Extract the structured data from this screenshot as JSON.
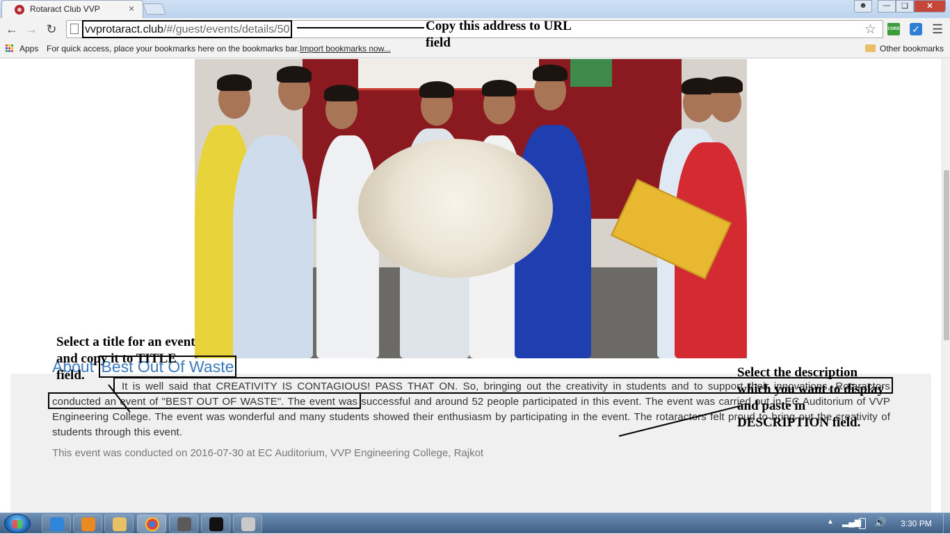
{
  "browser": {
    "tab_title": "Rotaract Club VVP",
    "tab_close": "×",
    "url_host": "vvprotaract.club",
    "url_path": "/#/guest/events/details/50",
    "icons": {
      "back": "arrow-left-icon",
      "forward": "arrow-right-icon",
      "reload": "reload-icon",
      "star": "star-icon",
      "menu": "hamburger-icon"
    },
    "extension_cors_label": "CORS",
    "extension_check_label": "✓",
    "bookmarks": {
      "apps_label": "Apps",
      "hint": "For quick access, place your bookmarks here on the bookmarks bar.",
      "import_label": "Import bookmarks now...",
      "other_label": "Other bookmarks"
    }
  },
  "event": {
    "about_prefix": "About",
    "title": "Best Out Of Waste",
    "description": "It is well said that CREATIVITY IS CONTAGIOUS! PASS THAT ON. So, bringing out the creativity in students and to support their innovations, Rotaractors conducted an event of \"BEST OUT OF WASTE\". The event was successful and around 52 people participated in this event. The event was carried out in EC Auditorium of VVP Engineering College. The event was wonderful and many students showed their enthusiasm by participating in the event. The rotaractors felt proud to bring out the creativity of students through this event.",
    "conducted_text": "This event was conducted on 2016-07-30 at EC Auditorium, VVP Engineering College, Rajkot"
  },
  "annotations": {
    "url": "Copy this address to URL field",
    "title": "Select a title for an event and copy it to TITLE field.",
    "description": "Select the description which you want to display and paste in DESCRIPTION field."
  },
  "taskbar": {
    "clock": "3:30 PM"
  },
  "colors": {
    "link_blue": "#3a7bbf",
    "panel_gray": "#f0f0f0",
    "tab_bar": "#c5d9f1"
  }
}
